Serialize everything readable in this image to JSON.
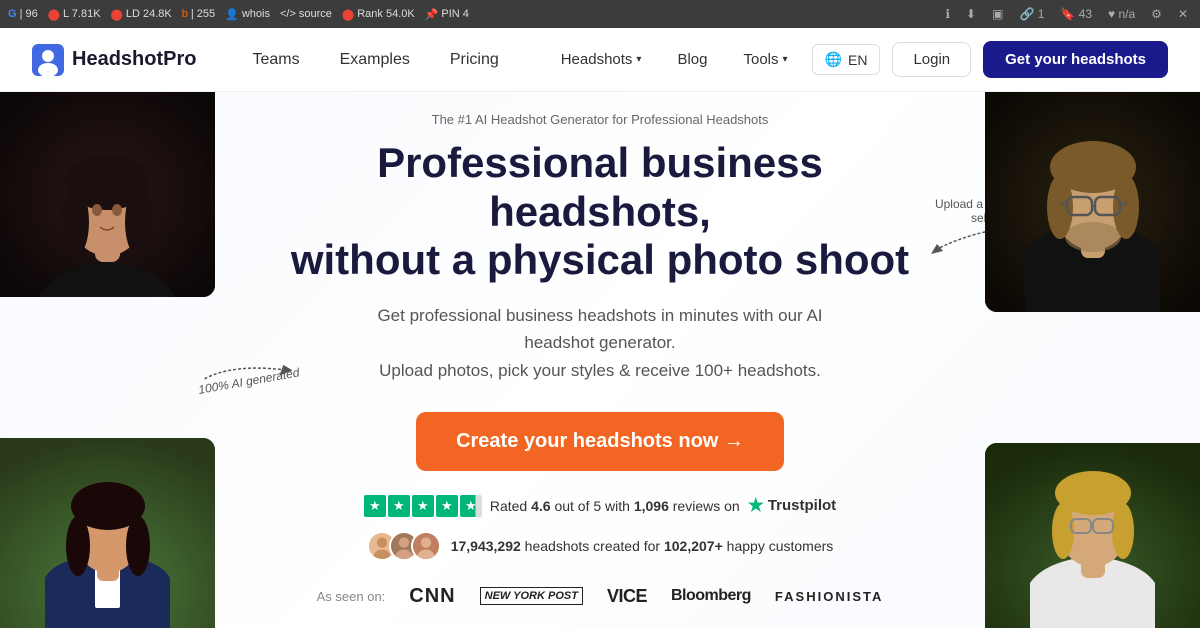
{
  "browser": {
    "metrics": [
      {
        "icon": "🌐",
        "label": "96",
        "color": "green"
      },
      {
        "prefix": "L",
        "label": "7.81K",
        "color": "red"
      },
      {
        "prefix": "LD",
        "label": "24.8K",
        "color": "red"
      },
      {
        "prefix": "b",
        "label": "255",
        "color": "orange"
      },
      {
        "prefix": "👤",
        "label": "whois",
        "color": "gray"
      },
      {
        "prefix": "</>",
        "label": "source",
        "color": "gray"
      },
      {
        "prefix": "Rank",
        "label": "54.0K",
        "color": "red"
      },
      {
        "prefix": "PIN",
        "label": "4",
        "color": "red"
      }
    ]
  },
  "navbar": {
    "logo_text": "HeadshotPro",
    "nav_links": [
      "Teams",
      "Examples",
      "Pricing"
    ],
    "right_links": [
      "Headshots",
      "Blog",
      "Tools"
    ],
    "lang_label": "EN",
    "login_label": "Login",
    "cta_label": "Get your headshots"
  },
  "hero": {
    "subtitle_top": "The #1 AI Headshot Generator for Professional Headshots",
    "title_line1": "Professional business headshots,",
    "title_line2": "without a physical photo shoot",
    "description": "Get professional business headshots in minutes with our AI headshot generator.\nUpload photos, pick your styles & receive 100+ headshots.",
    "cta_label": "Create your headshots now →",
    "annotation_left": "100% AI generated",
    "annotation_right": "Upload a few selfies",
    "trustpilot": {
      "prefix": "Rated",
      "rating": "4.6",
      "middle": "out of 5 with",
      "reviews": "1,096",
      "suffix": "reviews on",
      "brand": "Trustpilot"
    },
    "customers": {
      "count": "17,943,292",
      "suffix": "headshots created for",
      "happy": "102,207+",
      "happy_suffix": "happy customers"
    },
    "as_seen": {
      "label": "As seen on:",
      "outlets": [
        "CNN",
        "NEW YORK POST",
        "VICE",
        "Bloomberg",
        "FASHIONISTA"
      ]
    }
  }
}
